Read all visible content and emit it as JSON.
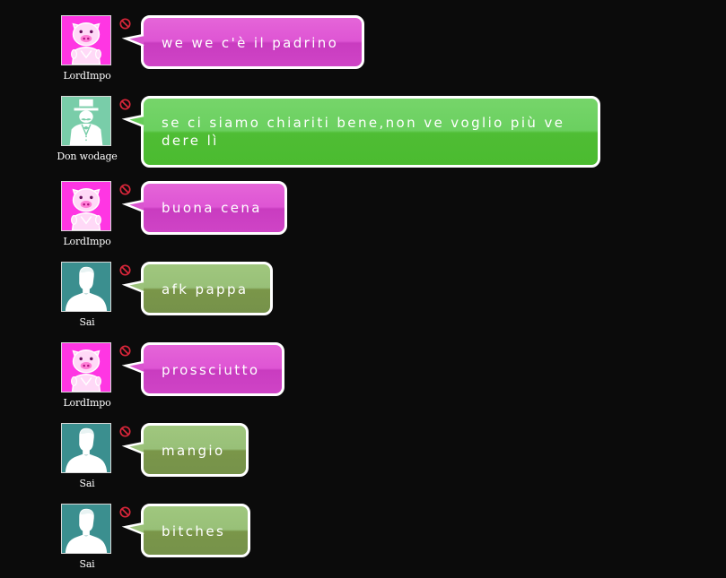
{
  "colors": {
    "background": "#0b0b0b",
    "pink_bubble": "#d64fcd",
    "green_bubble": "#5cc546",
    "olive_bubble": "#86a862",
    "block_icon": "#d9263a"
  },
  "messages": [
    {
      "user": "LordImpo",
      "avatar_icon": "pig-avatar-icon",
      "text": "we we c'è il padrino",
      "bubble_color": "pink"
    },
    {
      "user": "Don wodage",
      "avatar_icon": "top-hat-man-avatar-icon",
      "text": "se ci siamo chiariti bene,non ve voglio più ve dere lì",
      "bubble_color": "green"
    },
    {
      "user": "LordImpo",
      "avatar_icon": "pig-avatar-icon",
      "text": "buona cena",
      "bubble_color": "pink"
    },
    {
      "user": "Sai",
      "avatar_icon": "silhouette-avatar-icon",
      "text": "afk pappa",
      "bubble_color": "olive"
    },
    {
      "user": "LordImpo",
      "avatar_icon": "pig-avatar-icon",
      "text": "prossciutto",
      "bubble_color": "pink"
    },
    {
      "user": "Sai",
      "avatar_icon": "silhouette-avatar-icon",
      "text": "mangio",
      "bubble_color": "olive"
    },
    {
      "user": "Sai",
      "avatar_icon": "silhouette-avatar-icon",
      "text": "bitches",
      "bubble_color": "olive"
    }
  ]
}
